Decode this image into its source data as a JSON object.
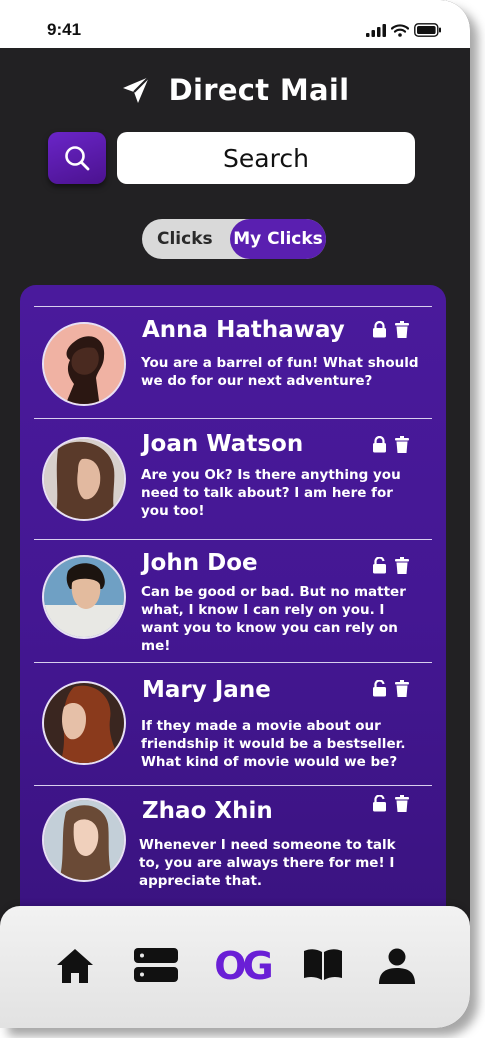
{
  "status_bar": {
    "time": "9:41"
  },
  "header": {
    "title": "Direct Mail",
    "icon": "paper-plane-icon"
  },
  "search": {
    "placeholder": "Search",
    "icon": "search-icon"
  },
  "toggle": {
    "option_1": "Clicks",
    "option_2": "My Clicks",
    "selected": "My Clicks"
  },
  "messages": [
    {
      "name": "Anna Hathaway",
      "text": "You are a barrel of fun! What should we do for our next adventure?",
      "lock": "locked"
    },
    {
      "name": "Joan Watson",
      "text": "Are you Ok? Is there anything you need to talk about? I am here for you too!",
      "lock": "locked"
    },
    {
      "name": "John Doe",
      "text": "Can be good or bad. But no matter what, I know I can rely on you. I want you to know you can rely on me!",
      "lock": "unlocked"
    },
    {
      "name": "Mary Jane",
      "text": "If they made a movie about our friendship it would be a bestseller. What kind of movie would we be?",
      "lock": "unlocked"
    },
    {
      "name": "Zhao Xhin",
      "text": "Whenever I need someone to talk to, you are always there for me! I appreciate that.",
      "lock": "unlocked"
    }
  ],
  "bottom_nav": {
    "items": [
      "home-icon",
      "server-icon",
      "og-logo",
      "book-icon",
      "profile-icon"
    ],
    "logo_text": "OG"
  },
  "colors": {
    "accent": "#5a1fb0",
    "panel": "#44178f",
    "background": "#222123"
  }
}
